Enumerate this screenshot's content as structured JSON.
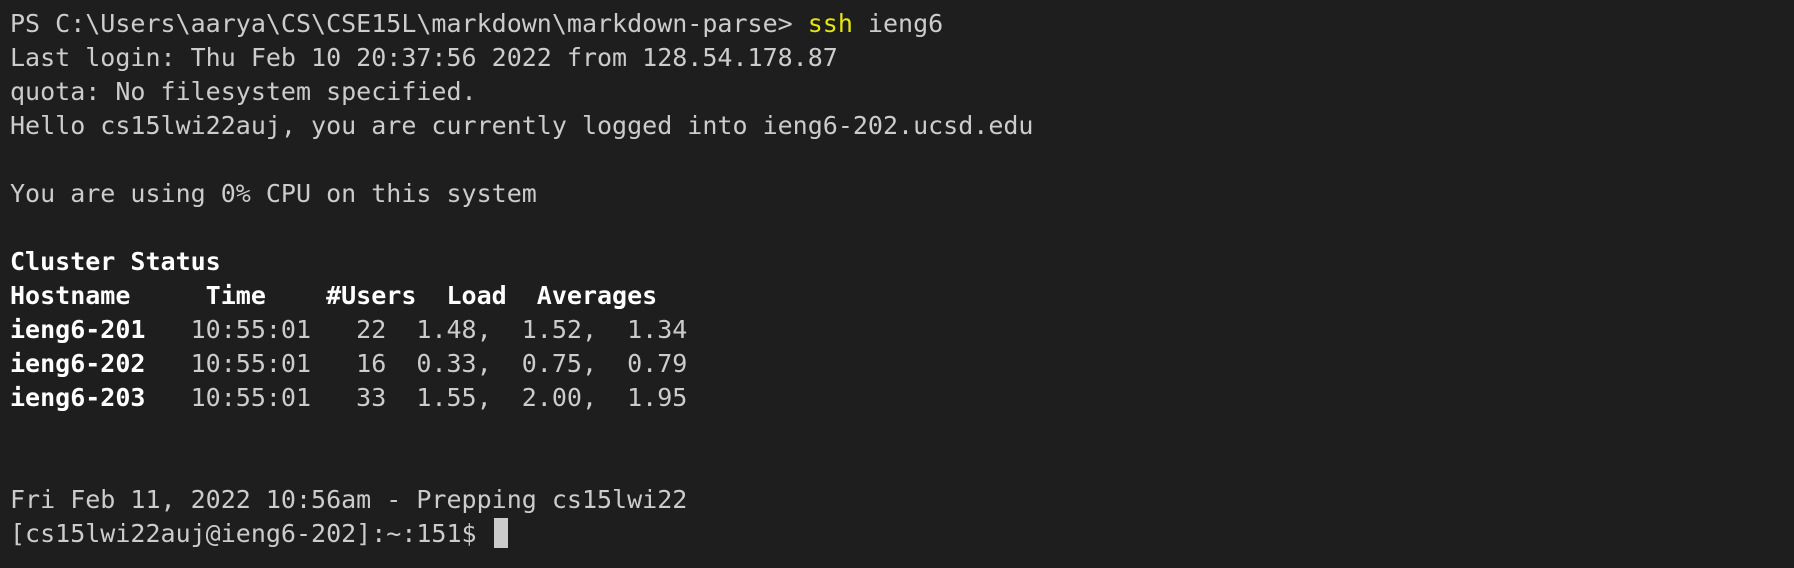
{
  "terminal": {
    "prompt_ps": "PS C:\\Users\\aarya\\CS\\CSE15L\\markdown\\markdown-parse> ",
    "command": "ssh",
    "command_arg": " ieng6",
    "last_login": "Last login: Thu Feb 10 20:37:56 2022 from 128.54.178.87",
    "quota": "quota: No filesystem specified.",
    "hello": "Hello cs15lwi22auj, you are currently logged into ieng6-202.ucsd.edu",
    "cpu": "You are using 0% CPU on this system",
    "cluster_title": "Cluster Status",
    "cluster_header": "Hostname     Time    #Users  Load  Averages",
    "hosts": [
      {
        "name": "ieng6-201",
        "rest": "   10:55:01   22  1.48,  1.52,  1.34"
      },
      {
        "name": "ieng6-202",
        "rest": "   10:55:01   16  0.33,  0.75,  0.79"
      },
      {
        "name": "ieng6-203",
        "rest": "   10:55:01   33  1.55,  2.00,  1.95"
      }
    ],
    "prepping": "Fri Feb 11, 2022 10:56am - Prepping cs15lwi22",
    "remote_prompt": "[cs15lwi22auj@ieng6-202]:~:151$ "
  },
  "colors": {
    "background": "#1e1e1e",
    "foreground": "#cccccc",
    "command": "#e5e510",
    "bold": "#ffffff"
  }
}
